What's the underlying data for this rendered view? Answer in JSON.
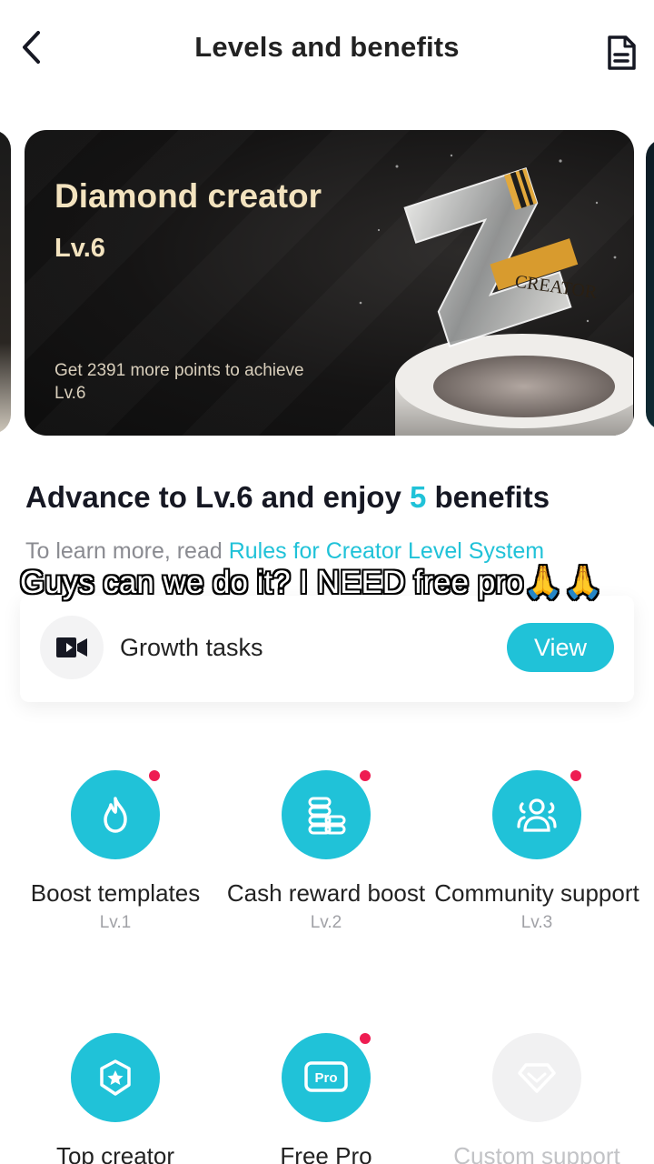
{
  "header": {
    "title": "Levels and benefits"
  },
  "level_card": {
    "title": "Diamond creator",
    "level": "Lv.6",
    "progress_text": "Get 2391 more points to achieve Lv.6",
    "trophy_label": "CREATOR"
  },
  "advance": {
    "title_prefix": "Advance to Lv.6 and enjoy ",
    "benefit_count": "5",
    "title_suffix": " benefits",
    "rules_prefix": "To learn more, read ",
    "rules_link": "Rules for Creator Level System"
  },
  "overlay_caption": "Guys can we do it? I NEED free pro🙏🙏",
  "growth_tasks": {
    "label": "Growth tasks",
    "button": "View"
  },
  "benefits": [
    {
      "name": "Boost templates",
      "level": "Lv.1",
      "icon": "flame-icon",
      "new_dot": true,
      "locked": false
    },
    {
      "name": "Cash reward boost",
      "level": "Lv.2",
      "icon": "coins-icon",
      "new_dot": true,
      "locked": false
    },
    {
      "name": "Community support",
      "level": "Lv.3",
      "icon": "people-icon",
      "new_dot": true,
      "locked": false
    },
    {
      "name": "Top creator",
      "level": "",
      "icon": "star-badge-icon",
      "new_dot": false,
      "locked": false
    },
    {
      "name": "Free Pro",
      "level": "",
      "icon": "pro-icon",
      "new_dot": true,
      "locked": false
    },
    {
      "name": "Custom support",
      "level": "",
      "icon": "diamond-icon",
      "new_dot": false,
      "locked": true
    }
  ],
  "colors": {
    "accent": "#20c2d8",
    "notification_dot": "#ee1d52",
    "card_text": "#f3e3bf"
  }
}
